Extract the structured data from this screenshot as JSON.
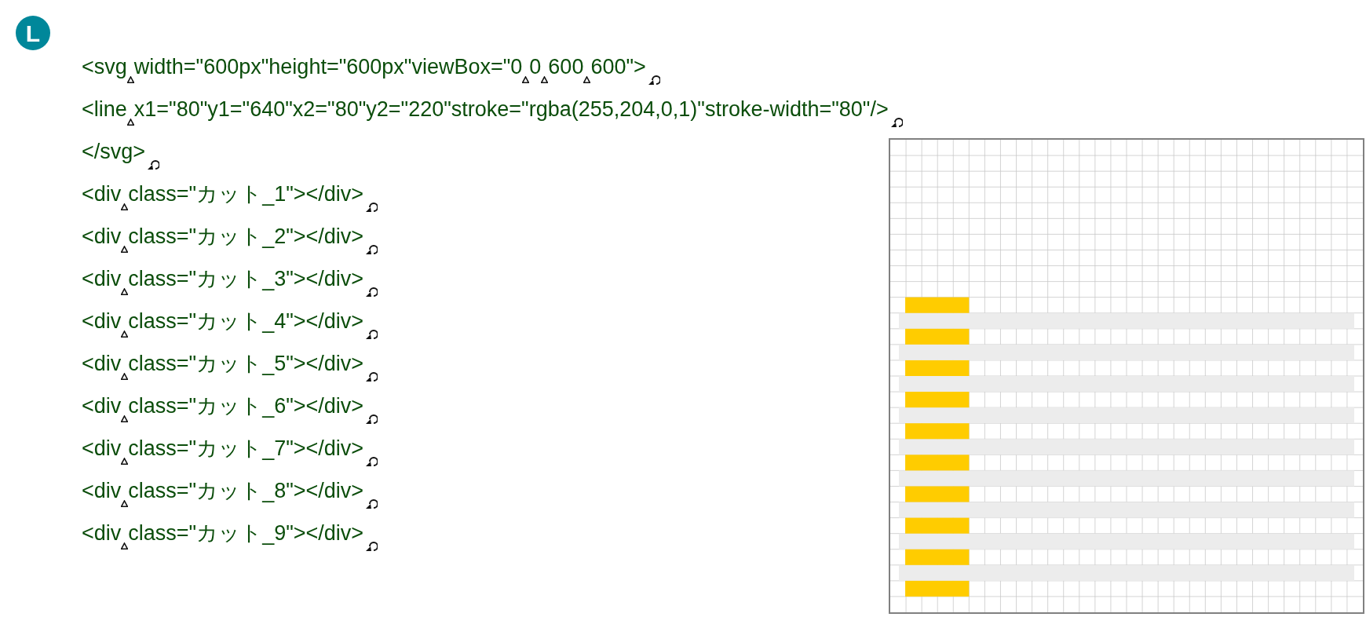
{
  "badge": "L",
  "code_lines": [
    {
      "parts": [
        "<svg",
        "width=\"600px\"height=\"600px\"viewBox=\"0",
        "0",
        "600",
        "600\">"
      ]
    },
    {
      "parts": [
        "<line",
        "x1=\"80\"y1=\"640\"x2=\"80\"y2=\"220\"stroke=\"rgba(255,204,0,1)\"stroke-width=\"80\"/>"
      ]
    },
    {
      "parts": [
        "</svg>"
      ]
    },
    {
      "parts": [
        "<div",
        "class=\"カット_1\"></div>"
      ]
    },
    {
      "parts": [
        "<div",
        "class=\"カット_2\"></div>"
      ]
    },
    {
      "parts": [
        "<div",
        "class=\"カット_3\"></div>"
      ]
    },
    {
      "parts": [
        "<div",
        "class=\"カット_4\"></div>"
      ]
    },
    {
      "parts": [
        "<div",
        "class=\"カット_5\"></div>"
      ]
    },
    {
      "parts": [
        "<div",
        "class=\"カット_6\"></div>"
      ]
    },
    {
      "parts": [
        "<div",
        "class=\"カット_7\"></div>"
      ]
    },
    {
      "parts": [
        "<div",
        "class=\"カット_8\"></div>"
      ]
    },
    {
      "parts": [
        "<div",
        "class=\"カット_9\"></div>"
      ]
    }
  ]
}
